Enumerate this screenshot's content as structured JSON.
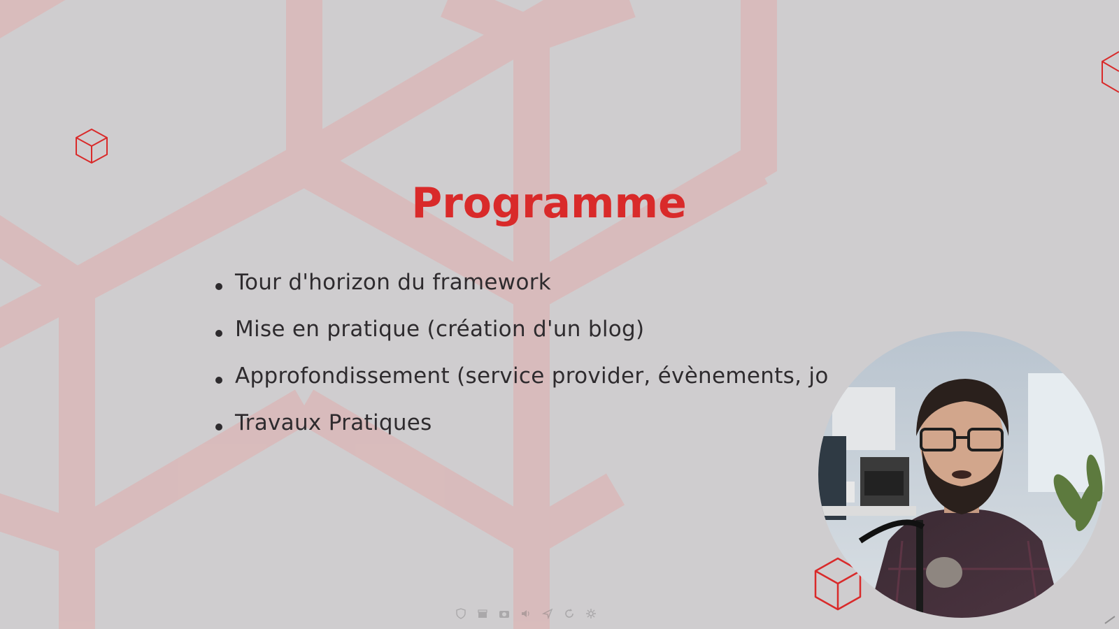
{
  "slide": {
    "title": "Programme",
    "bullets": [
      "Tour d'horizon du framework",
      "Mise en pratique (création d'un blog)",
      "Approfondissement (service provider, évènements, jo",
      "Travaux Pratiques"
    ]
  },
  "colors": {
    "accent": "#d92a2a",
    "background": "#cfcdcf",
    "text": "#2e2b2e",
    "hex_pattern": "#e0b9b9"
  },
  "icons": {
    "cube_top_left": "cube-outline-icon",
    "cube_bottom_right": "cube-outline-icon",
    "cube_top_right": "cube-outline-icon"
  },
  "webcam": {
    "icon": "presenter-webcam"
  },
  "controls": [
    {
      "name": "shield-icon"
    },
    {
      "name": "clapperboard-icon"
    },
    {
      "name": "camera-icon"
    },
    {
      "name": "volume-icon"
    },
    {
      "name": "pin-icon"
    },
    {
      "name": "refresh-icon"
    },
    {
      "name": "settings-icon"
    }
  ]
}
